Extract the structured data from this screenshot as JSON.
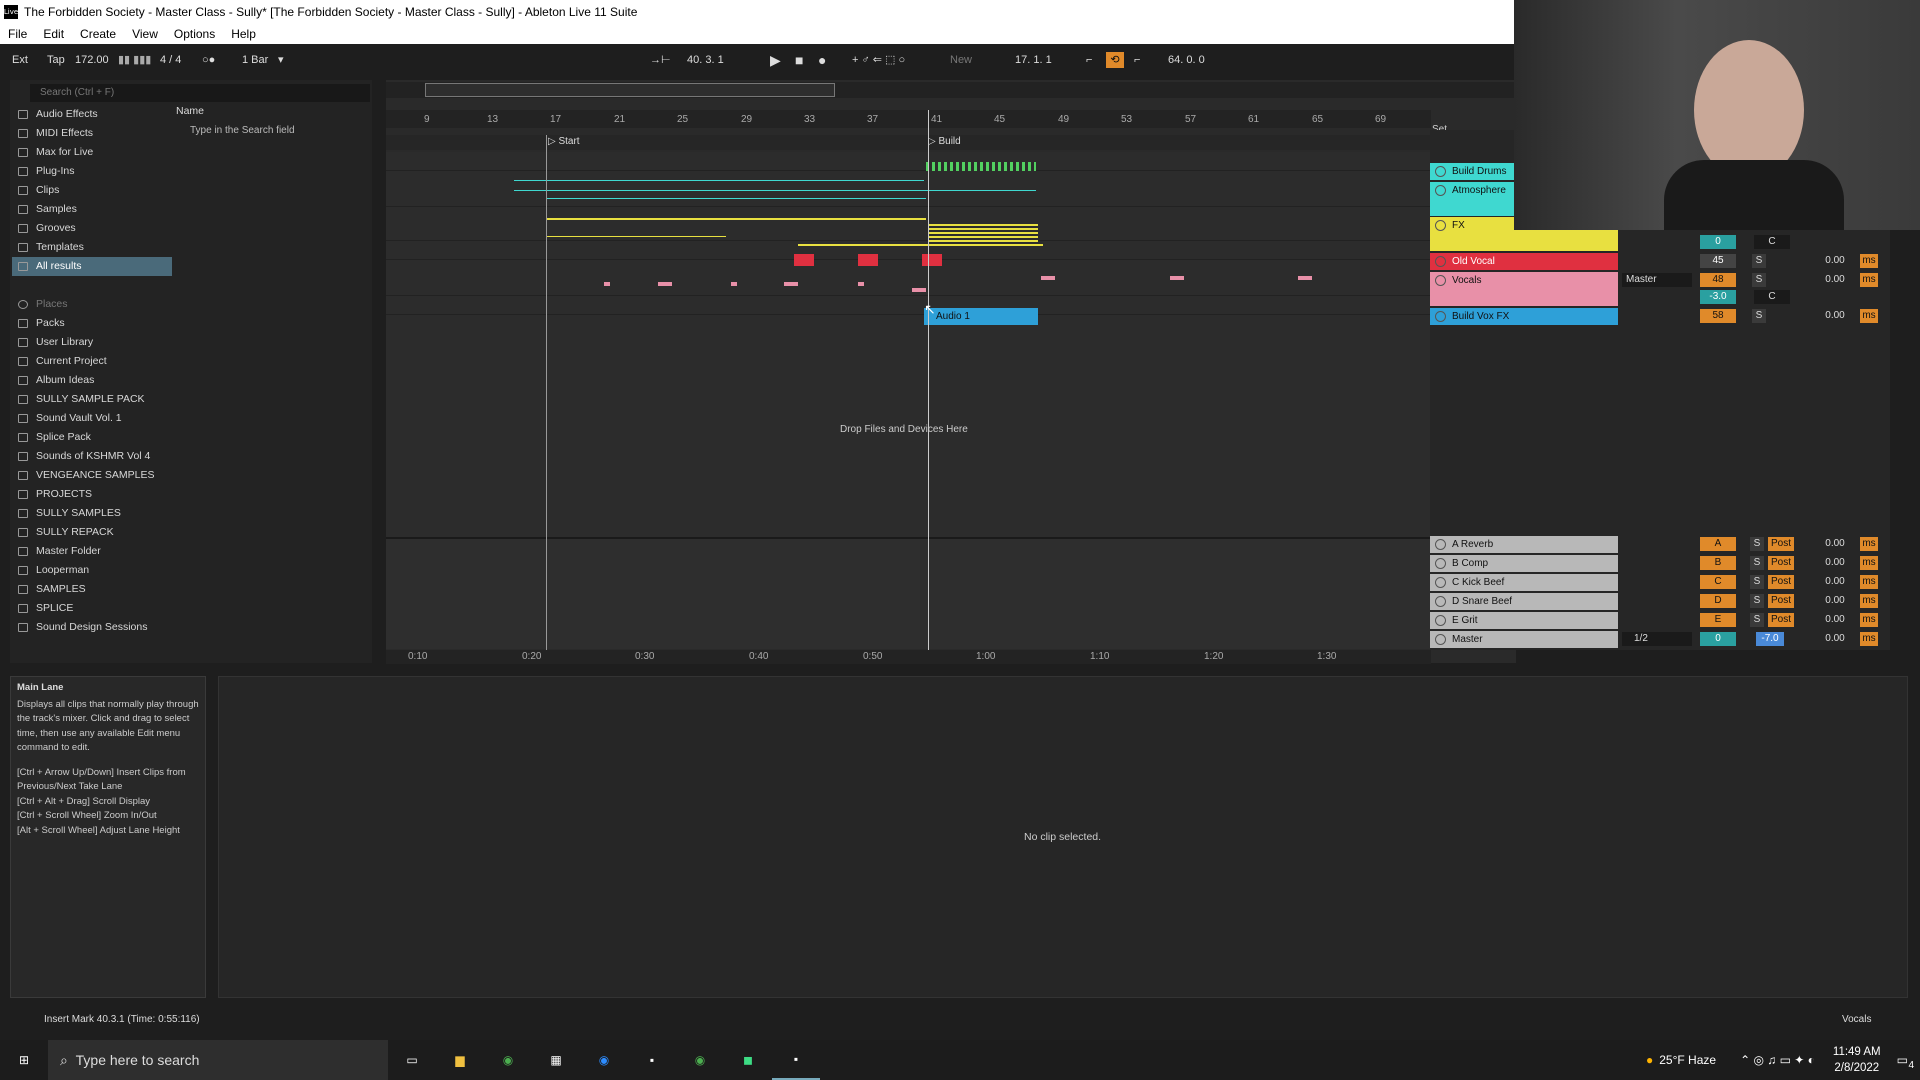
{
  "window": {
    "title": "The Forbidden Society - Master Class - Sully*  [The Forbidden Society - Master Class - Sully] - Ableton Live 11 Suite",
    "icon": "Live"
  },
  "menu": [
    "File",
    "Edit",
    "Create",
    "View",
    "Options",
    "Help"
  ],
  "transport": {
    "ext": "Ext",
    "tap": "Tap",
    "tempo": "172.00",
    "signature": "4 / 4",
    "quant": "1 Bar",
    "position": "40.  3.  1",
    "new": "New",
    "loop_start": "17.  1.  1",
    "loop_len": "64.  0.  0"
  },
  "browser": {
    "search_placeholder": "Search (Ctrl + F)",
    "name_header": "Name",
    "hint": "Type in the Search field",
    "categories": [
      "Audio Effects",
      "MIDI Effects",
      "Max for Live",
      "Plug-Ins",
      "Clips",
      "Samples",
      "Grooves",
      "Templates",
      "All results"
    ],
    "places_header": "Places",
    "places": [
      "Packs",
      "User Library",
      "Current Project",
      "Album Ideas",
      "SULLY SAMPLE PACK",
      "Sound Vault Vol. 1",
      "Splice Pack",
      "Sounds of KSHMR Vol 4",
      "VENGEANCE SAMPLES",
      "PROJECTS",
      "SULLY SAMPLES",
      "SULLY REPACK",
      "Master Folder",
      "Looperman",
      "SAMPLES",
      "SPLICE",
      "Sound Design Sessions"
    ]
  },
  "ruler": {
    "bars": [
      "9",
      "13",
      "17",
      "21",
      "25",
      "29",
      "33",
      "37",
      "41",
      "45",
      "49",
      "53",
      "57",
      "61",
      "65",
      "69"
    ],
    "set": "Set"
  },
  "locators": {
    "start": "Start",
    "build": "Build"
  },
  "time_ruler": [
    "0:10",
    "0:20",
    "0:30",
    "0:40",
    "0:50",
    "1:00",
    "1:10",
    "1:20",
    "1:30"
  ],
  "clip": {
    "name": "Audio 1"
  },
  "drop_hint": "Drop Files and Devices Here",
  "tracks": [
    {
      "name": "Build Drums",
      "color": "#3fd8d0"
    },
    {
      "name": "Atmosphere",
      "color": "#3fd8d0"
    },
    {
      "name": "FX",
      "color": "#e8e040",
      "vol": "0",
      "pan": "C"
    },
    {
      "name": "Old Vocal",
      "color": "#e03040",
      "vol": "45",
      "solo": "S",
      "delay": "0.00",
      "unit": "ms"
    },
    {
      "name": "Vocals",
      "color": "#e890a8",
      "route": "Master",
      "vol": "48",
      "vol2": "-3.0",
      "pan": "C",
      "solo": "S",
      "delay": "0.00",
      "unit": "ms"
    },
    {
      "name": "Build Vox FX",
      "color": "#2ea0d8",
      "vol": "58",
      "solo": "S",
      "delay": "0.00",
      "unit": "ms"
    }
  ],
  "returns": [
    {
      "name": "A Reverb",
      "send": "A",
      "solo": "S",
      "post": "Post",
      "delay": "0.00",
      "unit": "ms"
    },
    {
      "name": "B Comp",
      "send": "B",
      "solo": "S",
      "post": "Post",
      "delay": "0.00",
      "unit": "ms"
    },
    {
      "name": "C Kick Beef",
      "send": "C",
      "solo": "S",
      "post": "Post",
      "delay": "0.00",
      "unit": "ms"
    },
    {
      "name": "D Snare Beef",
      "send": "D",
      "solo": "S",
      "post": "Post",
      "delay": "0.00",
      "unit": "ms"
    },
    {
      "name": "E Grit",
      "send": "E",
      "solo": "S",
      "post": "Post",
      "delay": "0.00",
      "unit": "ms"
    },
    {
      "name": "Master",
      "route": "1/2",
      "vol": "0",
      "vol2": "-7.0",
      "delay": "0.00",
      "unit": "ms"
    }
  ],
  "info": {
    "title": "Main Lane",
    "body": "Displays all clips that normally play through the track's mixer. Click and drag to select time, then use any available Edit menu command to edit.",
    "shortcuts": [
      "[Ctrl + Arrow Up/Down] Insert Clips from Previous/Next Take Lane",
      "[Ctrl + Alt + Drag] Scroll Display",
      "[Ctrl + Scroll Wheel] Zoom In/Out",
      "[Alt + Scroll Wheel] Adjust Lane Height"
    ]
  },
  "detail": {
    "empty": "No clip selected."
  },
  "status": {
    "message": "Insert Mark 40.3.1 (Time: 0:55:116)",
    "track": "Vocals"
  },
  "taskbar": {
    "search": "Type here to search",
    "weather": "25°F  Haze",
    "time": "11:49 AM",
    "date": "2/8/2022",
    "notif": "4"
  }
}
